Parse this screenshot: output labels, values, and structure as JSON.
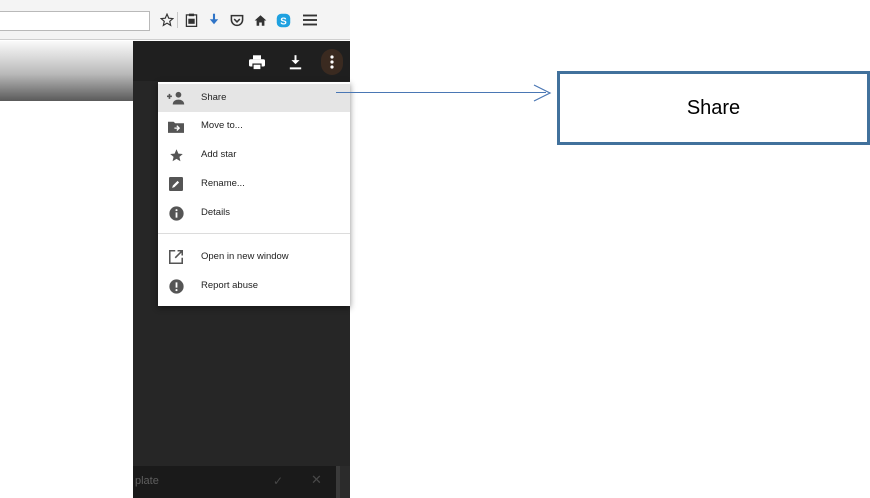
{
  "browser": {
    "address_value": "",
    "toolbar_icons": [
      "star-icon",
      "clipboard-icon",
      "download-icon",
      "pocket-icon",
      "home-icon",
      "skype-icon",
      "hamburger-menu-icon"
    ],
    "accent_blue": "#2f74c7",
    "skype_blue": "#1ea1e0"
  },
  "viewer": {
    "header_icons": [
      "print-icon",
      "download-icon",
      "more-vert-icon"
    ],
    "bottom_bar_text": "plate",
    "bottom_bar_icons": [
      "check-icon",
      "close-icon"
    ]
  },
  "menu": {
    "items": [
      {
        "label": "Share",
        "icon": "add-person-icon",
        "highlighted": true
      },
      {
        "label": "Move to...",
        "icon": "folder-move-icon",
        "highlighted": false
      },
      {
        "label": "Add star",
        "icon": "star-icon",
        "highlighted": false
      },
      {
        "label": "Rename...",
        "icon": "edit-icon",
        "highlighted": false
      },
      {
        "label": "Details",
        "icon": "info-icon",
        "highlighted": false
      },
      {
        "label": "Open in new window",
        "icon": "open-new-icon",
        "highlighted": false
      },
      {
        "label": "Report abuse",
        "icon": "report-icon",
        "highlighted": false
      }
    ]
  },
  "callout": {
    "label": "Share",
    "line_color": "#4a77b4",
    "border_color": "#41719c"
  }
}
